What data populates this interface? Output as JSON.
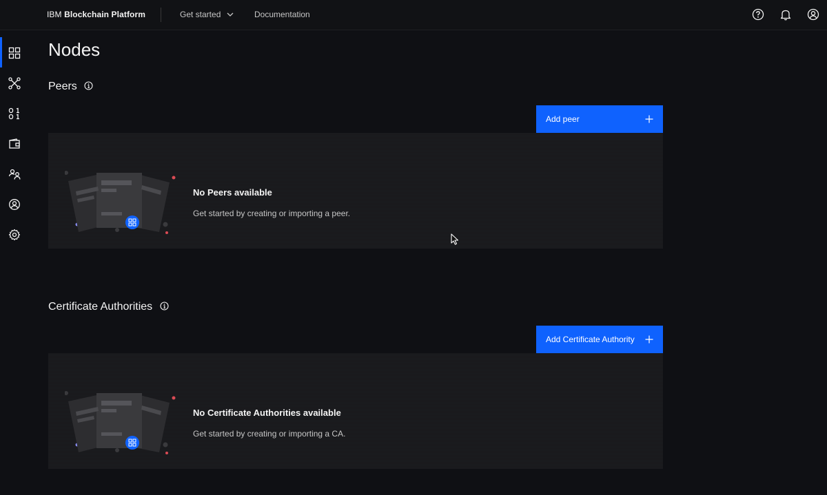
{
  "header": {
    "brand_prefix": "IBM ",
    "brand_name": "Blockchain Platform",
    "nav": {
      "get_started": "Get started",
      "documentation": "Documentation"
    },
    "icons": [
      "help-icon",
      "notification-bell-icon",
      "user-avatar-icon"
    ]
  },
  "sidebar": {
    "items": [
      {
        "name": "nodes",
        "icon": "grid-icon",
        "active": true
      },
      {
        "name": "channels",
        "icon": "network-icon",
        "active": false
      },
      {
        "name": "smart-contracts",
        "icon": "binary-icon",
        "active": false
      },
      {
        "name": "wallet",
        "icon": "wallet-icon",
        "active": false
      },
      {
        "name": "organizations",
        "icon": "users-icon",
        "active": false
      },
      {
        "name": "users",
        "icon": "user-circle-icon",
        "active": false
      },
      {
        "name": "settings",
        "icon": "gear-icon",
        "active": false
      }
    ]
  },
  "main": {
    "page_title": "Nodes",
    "peers": {
      "title": "Peers",
      "add_label": "Add peer",
      "empty_title": "No Peers available",
      "empty_desc": "Get started by creating or importing a peer."
    },
    "cas": {
      "title": "Certificate Authorities",
      "add_label": "Add Certificate Authority",
      "empty_title": "No Certificate Authorities available",
      "empty_desc": "Get started by creating or importing a CA."
    }
  },
  "colors": {
    "background": "#0f1014",
    "primary_button": "#0f62fe",
    "tile": "#1c1c1f",
    "text": "#f4f4f4"
  }
}
